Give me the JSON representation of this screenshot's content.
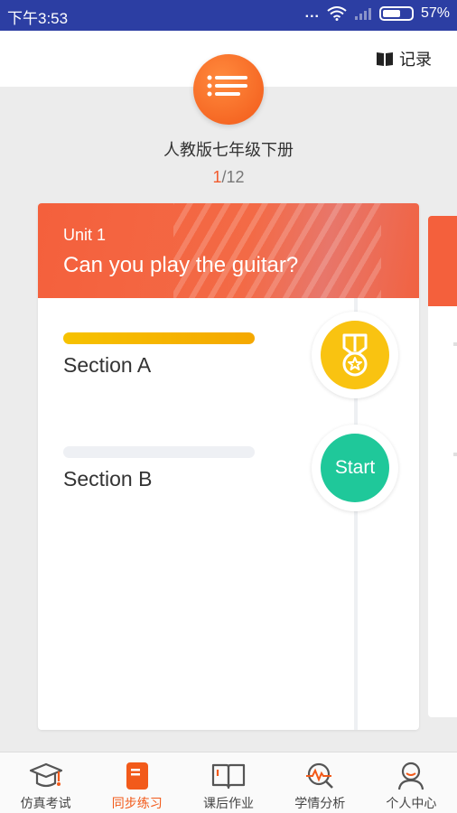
{
  "status_bar": {
    "time": "下午3:53",
    "dots": "...",
    "battery": "57%",
    "battery_level": 0.57
  },
  "header": {
    "record_label": "记录",
    "record_icon": "book-icon"
  },
  "book": {
    "icon": "list-icon",
    "title": "人教版七年级下册",
    "current_page": "1",
    "total_pages": "/12"
  },
  "card": {
    "unit_label": "Unit 1",
    "unit_title": "Can you play the guitar?",
    "sections": [
      {
        "label": "Section A",
        "progress": 1.0,
        "status_icon": "medal-icon"
      },
      {
        "label": "Section B",
        "progress": 0.0,
        "action_label": "Start"
      }
    ]
  },
  "colors": {
    "accent": "#f25a1a",
    "status_bar": "#2c3ea3",
    "medal": "#f9c311",
    "start": "#1fc89a"
  },
  "bottom_nav": {
    "items": [
      {
        "label": "仿真考试",
        "icon": "graduation-cap-icon"
      },
      {
        "label": "同步练习",
        "icon": "document-icon",
        "active": true
      },
      {
        "label": "课后作业",
        "icon": "open-book-icon"
      },
      {
        "label": "学情分析",
        "icon": "analytics-icon"
      },
      {
        "label": "个人中心",
        "icon": "user-icon"
      }
    ]
  }
}
